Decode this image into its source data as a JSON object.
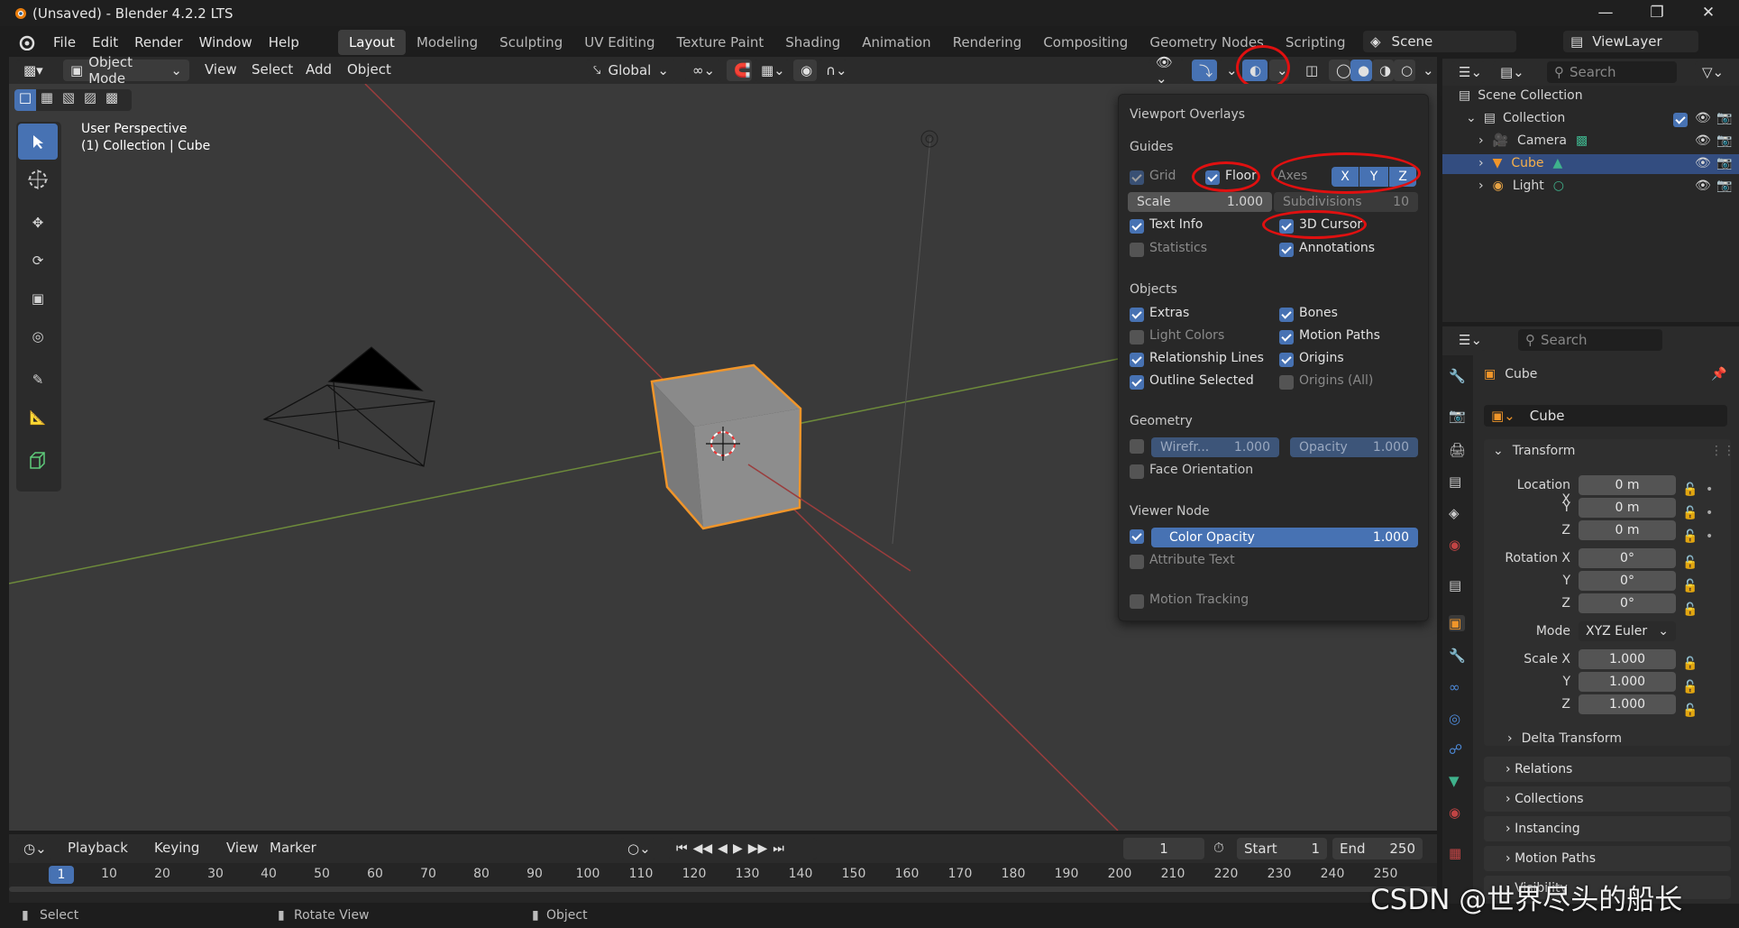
{
  "window": {
    "title": "(Unsaved) - Blender 4.2.2 LTS"
  },
  "menu": [
    "File",
    "Edit",
    "Render",
    "Window",
    "Help"
  ],
  "workspaces": [
    "Layout",
    "Modeling",
    "Sculpting",
    "UV Editing",
    "Texture Paint",
    "Shading",
    "Animation",
    "Rendering",
    "Compositing",
    "Geometry Nodes",
    "Scripting"
  ],
  "scene": {
    "name": "Scene",
    "viewlayer": "ViewLayer"
  },
  "header": {
    "mode": "Object Mode",
    "menus": [
      "View",
      "Select",
      "Add",
      "Object"
    ],
    "orientation": "Global"
  },
  "viewport": {
    "perspective": "User Perspective",
    "collection_info": "(1) Collection | Cube"
  },
  "overlays": {
    "title": "Viewport Overlays",
    "guides_title": "Guides",
    "grid": "Grid",
    "floor": "Floor",
    "axes": "Axes",
    "x": "X",
    "y": "Y",
    "z": "Z",
    "scale_label": "Scale",
    "scale_value": "1.000",
    "subdiv_label": "Subdivisions",
    "subdiv_value": "10",
    "text_info": "Text Info",
    "cursor": "3D Cursor",
    "statistics": "Statistics",
    "annotations": "Annotations",
    "objects_title": "Objects",
    "extras": "Extras",
    "bones": "Bones",
    "light_colors": "Light Colors",
    "motion_paths": "Motion Paths",
    "relationship_lines": "Relationship Lines",
    "origins": "Origins",
    "outline_selected": "Outline Selected",
    "origins_all": "Origins (All)",
    "geometry_title": "Geometry",
    "wireframe_label": "Wirefr...",
    "wireframe_value": "1.000",
    "opacity_label": "Opacity",
    "opacity_value": "1.000",
    "face_orientation": "Face Orientation",
    "viewer_title": "Viewer Node",
    "color_opacity_label": "Color Opacity",
    "color_opacity_value": "1.000",
    "attribute_text": "Attribute Text",
    "motion_tracking": "Motion Tracking"
  },
  "outliner": {
    "search_placeholder": "Search",
    "scene_collection": "Scene Collection",
    "collection": "Collection",
    "items": [
      "Camera",
      "Cube",
      "Light"
    ]
  },
  "properties": {
    "search_placeholder": "Search",
    "object_name": "Cube",
    "data_name": "Cube",
    "transform": "Transform",
    "loc_x_label": "Location X",
    "y_label": "Y",
    "z_label": "Z",
    "loc_x": "0 m",
    "loc_y": "0 m",
    "loc_z": "0 m",
    "rot_x_label": "Rotation X",
    "rot_x": "0°",
    "rot_y": "0°",
    "rot_z": "0°",
    "mode_label": "Mode",
    "mode_value": "XYZ Euler",
    "scale_x_label": "Scale X",
    "scale_x": "1.000",
    "scale_y": "1.000",
    "scale_z": "1.000",
    "delta": "Delta Transform",
    "panels": [
      "Relations",
      "Collections",
      "Instancing",
      "Motion Paths",
      "Visibility"
    ]
  },
  "timeline": {
    "menus": [
      "Playback",
      "Keying",
      "View",
      "Marker"
    ],
    "current_frame": "1",
    "start_label": "Start",
    "start": "1",
    "end_label": "End",
    "end": "250",
    "current_marker": "1",
    "ticks": [
      "10",
      "20",
      "30",
      "40",
      "50",
      "60",
      "70",
      "80",
      "90",
      "100",
      "110",
      "120",
      "130",
      "140",
      "150",
      "160",
      "170",
      "180",
      "190",
      "200",
      "210",
      "220",
      "230",
      "240",
      "250"
    ]
  },
  "status": {
    "select": "Select",
    "rotate": "Rotate View",
    "object": "Object"
  },
  "watermark": "CSDN @世界尽头的船长"
}
